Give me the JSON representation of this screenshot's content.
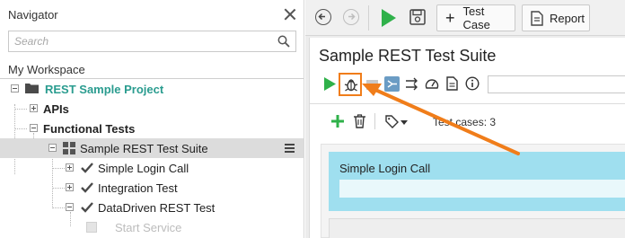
{
  "navigator": {
    "title": "Navigator",
    "search_placeholder": "Search",
    "workspace_label": "My Workspace",
    "tree": [
      {
        "label": "REST Sample Project",
        "style": "project",
        "expander": "minus",
        "icon": "folder-icon"
      },
      {
        "label": "APIs",
        "style": "bold",
        "expander": "plus"
      },
      {
        "label": "Functional Tests",
        "style": "bold",
        "expander": "minus"
      },
      {
        "label": "Sample REST Test Suite",
        "style": "normal",
        "expander": "minus",
        "icon": "suite-grid-icon",
        "selected": true
      },
      {
        "label": "Simple Login Call",
        "style": "normal",
        "expander": "plus",
        "icon": "check-icon"
      },
      {
        "label": "Integration Test",
        "style": "normal",
        "expander": "plus",
        "icon": "check-icon"
      },
      {
        "label": "DataDriven REST Test",
        "style": "normal",
        "expander": "minus",
        "icon": "check-icon"
      },
      {
        "label": "Start Service",
        "style": "muted"
      }
    ]
  },
  "toolbar": {
    "back_icon": "back-arrow-icon",
    "forward_icon": "forward-arrow-icon",
    "run_icon": "run-icon",
    "save_icon": "save-icon",
    "test_case_button": "Test Case",
    "report_button": "Report"
  },
  "editor": {
    "suite_title": "Sample REST Test Suite",
    "suite_icons": [
      "run-icon",
      "debug-bug-icon",
      "stop-icon",
      "step-into-icon",
      "transfer-arrows-icon",
      "speedometer-icon",
      "document-icon",
      "info-icon"
    ],
    "test_case_count": "Test cases: 3",
    "test_cases": [
      {
        "name": "Simple Login Call"
      }
    ]
  },
  "colors": {
    "accent_green": "#2fb14a",
    "project_teal": "#2a9c8f",
    "highlight_orange": "#f07d1a",
    "selected_row": "#dcdcdc",
    "test_card": "#9fdfef"
  }
}
